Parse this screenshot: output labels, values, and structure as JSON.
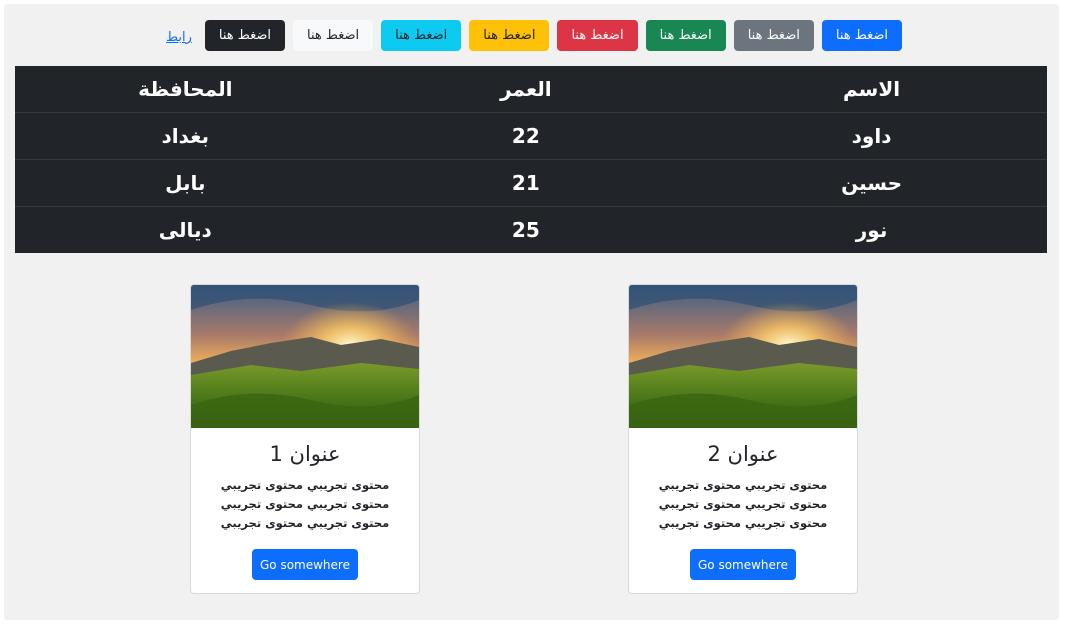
{
  "buttons": {
    "primary": "اضغط هنا",
    "secondary": "اضغط هنا",
    "success": "اضغط هنا",
    "danger": "اضغط هنا",
    "warning": "اضغط هنا",
    "info": "اضغط هنا",
    "light": "اضغط هنا",
    "dark": "اضغط هنا",
    "link": "رابط"
  },
  "colors": {
    "primary": "#0d6efd",
    "secondary": "#6c757d",
    "success": "#198754",
    "danger": "#dc3545",
    "warning": "#ffc107",
    "info": "#0dcaf0",
    "light": "#f8f9fa",
    "dark": "#212529",
    "page_bg": "#f1f1f1"
  },
  "table": {
    "headers": [
      "الاسم",
      "العمر",
      "المحافظة"
    ],
    "rows": [
      [
        "داود",
        "22",
        "بغداد"
      ],
      [
        "حسين",
        "21",
        "بابل"
      ],
      [
        "نور",
        "25",
        "ديالى"
      ]
    ]
  },
  "cards": [
    {
      "image": "mountain-sunset-meadow",
      "title": "عنوان 1",
      "text": "محتوى تجريبي محتوى تجريبي محتوى تجريبي محتوى تجريبي محتوى تجريبي محتوى تجريبي",
      "button": "Go somewhere"
    },
    {
      "image": "mountain-sunset-meadow",
      "title": "عنوان 2",
      "text": "محتوى تجريبي محتوى تجريبي محتوى تجريبي محتوى تجريبي محتوى تجريبي محتوى تجريبي",
      "button": "Go somewhere"
    }
  ]
}
